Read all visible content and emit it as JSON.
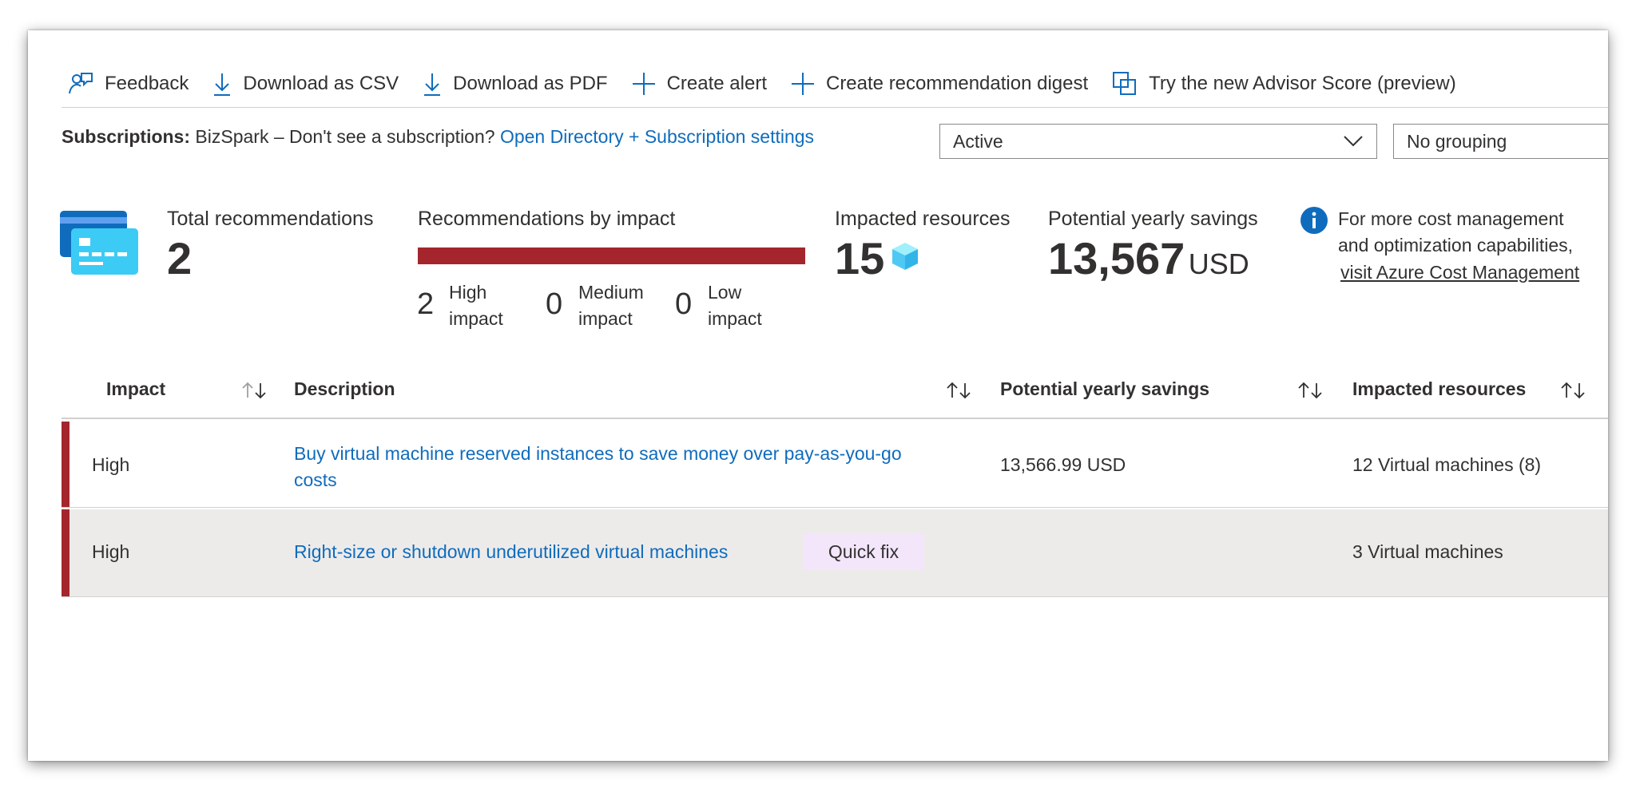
{
  "toolbar": {
    "feedback": "Feedback",
    "download_csv": "Download as CSV",
    "download_pdf": "Download as PDF",
    "create_alert": "Create alert",
    "create_digest": "Create recommendation digest",
    "advisor_score": "Try the new Advisor Score (preview)"
  },
  "subscriptions": {
    "label": "Subscriptions:",
    "text": "BizSpark – Don't see a subscription?",
    "link": "Open Directory + Subscription settings"
  },
  "filters": {
    "status": "Active",
    "grouping": "No grouping"
  },
  "summary": {
    "total_label": "Total recommendations",
    "total_value": "2",
    "by_impact_label": "Recommendations by impact",
    "high_count": "2",
    "high_label_1": "High",
    "high_label_2": "impact",
    "medium_count": "0",
    "medium_label_1": "Medium",
    "medium_label_2": "impact",
    "low_count": "0",
    "low_label_1": "Low",
    "low_label_2": "impact",
    "resources_label": "Impacted resources",
    "resources_value": "15",
    "savings_label": "Potential yearly savings",
    "savings_value": "13,567",
    "savings_unit": "USD",
    "info_line1": "For more cost management",
    "info_line2": "and optimization capabilities,",
    "info_link": "visit Azure Cost Management"
  },
  "table": {
    "headers": {
      "impact": "Impact",
      "description": "Description",
      "savings": "Potential yearly savings",
      "resources": "Impacted resources"
    },
    "rows": [
      {
        "impact": "High",
        "description_line1": "Buy virtual machine reserved instances to save money over pay-as-you-go",
        "description_line2": "costs",
        "savings": "13,566.99 USD",
        "resources": "12 Virtual machines (8)"
      },
      {
        "impact": "High",
        "description": "Right-size or shutdown underutilized virtual machines",
        "badge": "Quick fix",
        "savings": "",
        "resources": "3 Virtual machines"
      }
    ]
  },
  "colors": {
    "accent_link": "#0f6cbd",
    "high_impact": "#a4262c",
    "selected_row": "#edebe9",
    "quick_fix_bg": "#f3e6fb"
  }
}
